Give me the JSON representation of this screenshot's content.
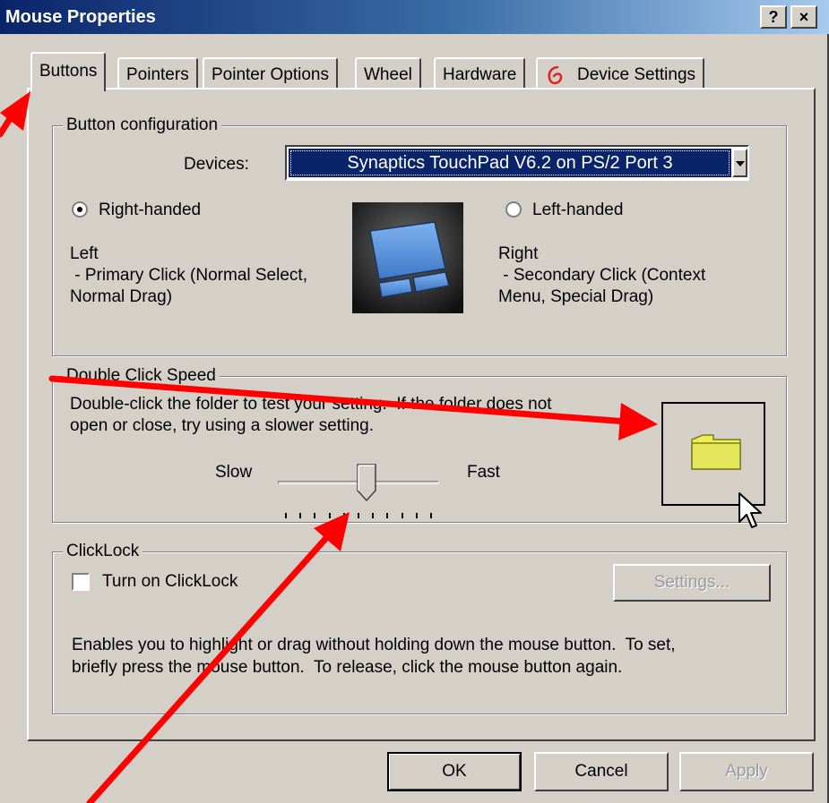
{
  "window": {
    "title": "Mouse Properties",
    "help_label": "?",
    "close_label": "×"
  },
  "tabs": [
    {
      "label": "Buttons",
      "active": true
    },
    {
      "label": "Pointers"
    },
    {
      "label": "Pointer Options"
    },
    {
      "label": "Wheel"
    },
    {
      "label": "Hardware"
    },
    {
      "label": "Device Settings"
    }
  ],
  "button_config": {
    "legend": "Button configuration",
    "devices_label": "Devices:",
    "device_selected": "Synaptics TouchPad V6.2 on PS/2 Port 3",
    "right_handed": {
      "label": "Right-handed",
      "checked": true
    },
    "left_handed": {
      "label": "Left-handed",
      "checked": false
    },
    "left_title": "Left",
    "left_desc_1": " - Primary Click (Normal Select,",
    "left_desc_2": "Normal Drag)",
    "right_title": "Right",
    "right_desc_1": " - Secondary Click (Context",
    "right_desc_2": "Menu, Special Drag)"
  },
  "double_click": {
    "legend": "Double Click Speed",
    "instructions_1": "Double-click the folder to test your setting.  If the folder does not",
    "instructions_2": "open or close, try using a slower setting.",
    "slow_label": "Slow",
    "fast_label": "Fast",
    "speed_value": 0.55
  },
  "clicklock": {
    "legend": "ClickLock",
    "checkbox_label": "Turn on ClickLock",
    "checked": false,
    "settings_label": "Settings...",
    "desc_1": "Enables you to highlight or drag without holding down the mouse button.  To set,",
    "desc_2": "briefly press the mouse button.  To release, click the mouse button again."
  },
  "footer": {
    "ok_label": "OK",
    "cancel_label": "Cancel",
    "apply_label": "Apply"
  },
  "colors": {
    "title_bar": "#0a246a",
    "dialog_bg": "#d4d0c8",
    "selection": "#0a246a",
    "annotation_arrows": "#ff0000"
  }
}
